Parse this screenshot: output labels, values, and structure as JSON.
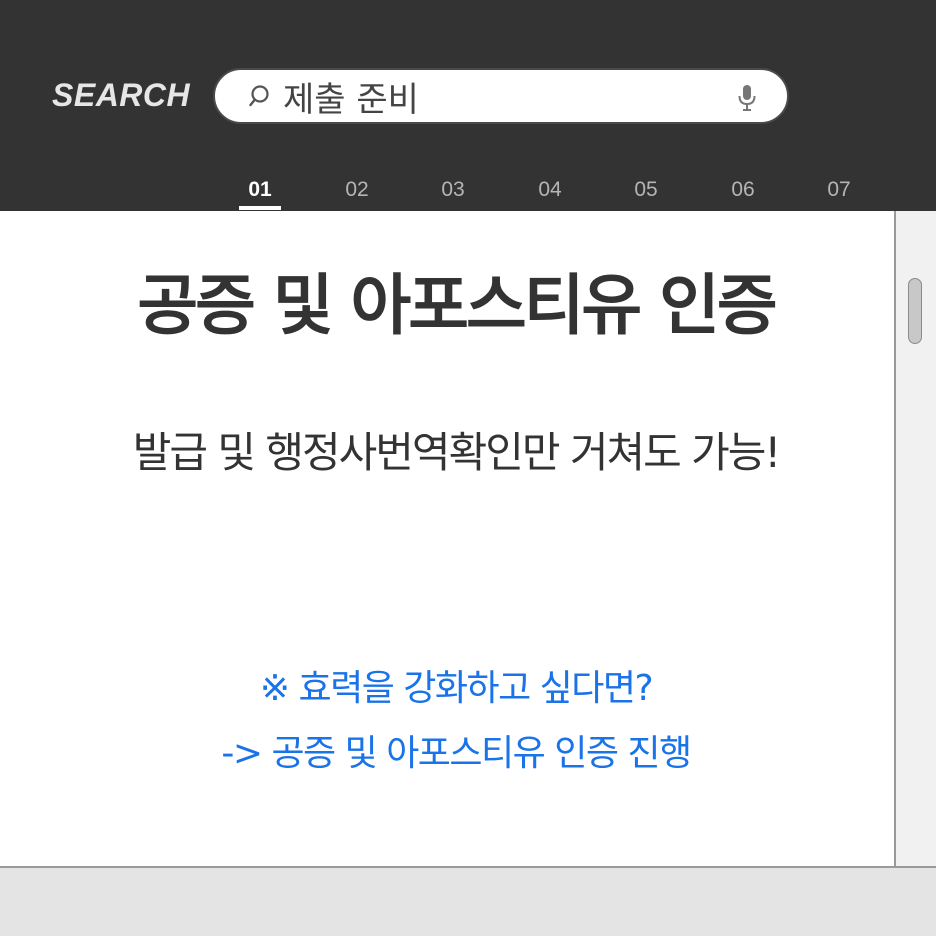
{
  "header": {
    "brand": "SEARCH",
    "search": {
      "value": "제출 준비",
      "placeholder": ""
    },
    "icons": {
      "search": "search-icon",
      "mic": "mic-icon"
    },
    "tabs": [
      {
        "label": "01",
        "active": true
      },
      {
        "label": "02",
        "active": false
      },
      {
        "label": "03",
        "active": false
      },
      {
        "label": "04",
        "active": false
      },
      {
        "label": "05",
        "active": false
      },
      {
        "label": "06",
        "active": false
      },
      {
        "label": "07",
        "active": false
      }
    ]
  },
  "main": {
    "title": "공증 및 아포스티유 인증",
    "subtitle": "발급 및 행정사번역확인만 거쳐도 가능!",
    "note_line1": "※ 효력을 강화하고 싶다면?",
    "note_line2": "-> 공증 및 아포스티유 인증 진행"
  },
  "colors": {
    "header_bg": "#333333",
    "accent_blue": "#1a73e8",
    "text_dark": "#333333",
    "tab_inactive": "#b5b5b5",
    "tab_active": "#ffffff"
  }
}
